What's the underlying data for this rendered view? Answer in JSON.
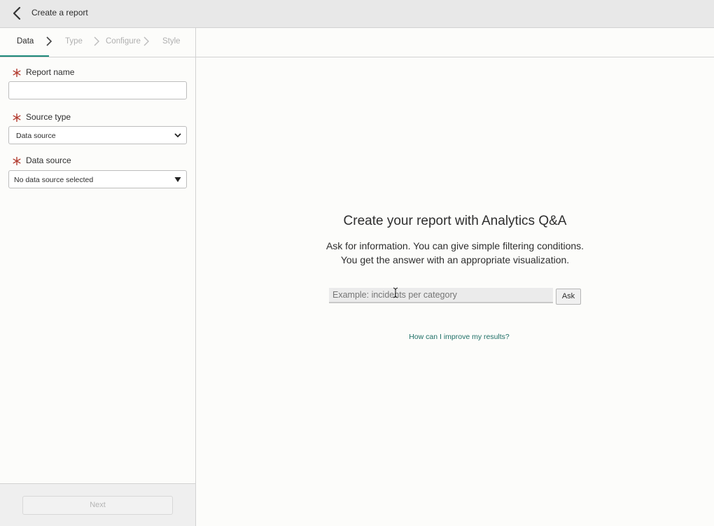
{
  "header": {
    "title": "Create a report"
  },
  "steps": [
    {
      "label": "Data",
      "active": true
    },
    {
      "label": "Type",
      "active": false
    },
    {
      "label": "Configure",
      "active": false
    },
    {
      "label": "Style",
      "active": false
    }
  ],
  "form": {
    "report_name": {
      "label": "Report name",
      "value": ""
    },
    "source_type": {
      "label": "Source type",
      "value": "Data source"
    },
    "data_source": {
      "label": "Data source",
      "value": "No data source selected"
    }
  },
  "footer": {
    "next_label": "Next"
  },
  "qa": {
    "title": "Create your report with Analytics Q&A",
    "desc_line1": "Ask for information. You can give simple filtering conditions.",
    "desc_line2": "You get the answer with an appropriate visualization.",
    "placeholder": "Example: incidents per category",
    "ask_label": "Ask",
    "help_link": "How can I improve my results?"
  },
  "colors": {
    "accent": "#1e8a7a",
    "required": "#b23a2e",
    "link": "#1e6f66"
  }
}
